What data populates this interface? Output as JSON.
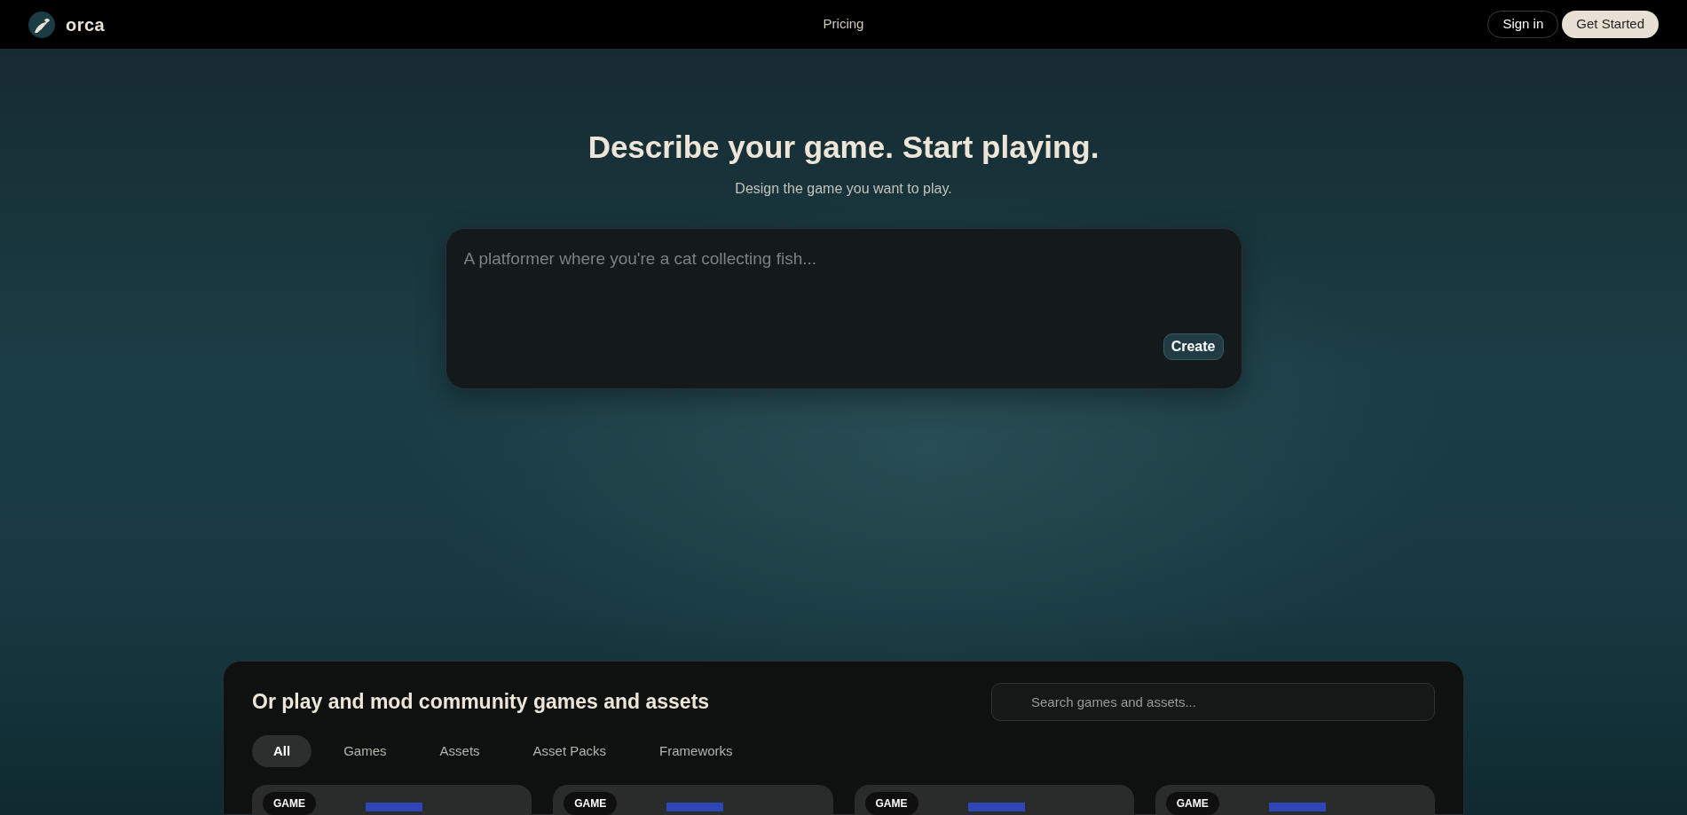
{
  "nav": {
    "brand": "orca",
    "links": [
      "Pricing"
    ],
    "sign_in": "Sign in",
    "get_started": "Get Started"
  },
  "hero": {
    "title": "Describe your game. Start playing.",
    "subtitle": "Design the game you want to play.",
    "prompt": {
      "placeholder": "A platformer where you're a cat collecting fish..."
    },
    "create": "Create"
  },
  "community": {
    "title": "Or play and mod community games and assets",
    "search": {
      "placeholder": "Search games and assets..."
    },
    "tabs": [
      {
        "label": "All",
        "selected": true
      },
      {
        "label": "Games",
        "selected": false
      },
      {
        "label": "Assets",
        "selected": false
      },
      {
        "label": "Asset Packs",
        "selected": false
      },
      {
        "label": "Frameworks",
        "selected": false
      }
    ],
    "cards": [
      {
        "badge": "GAME"
      },
      {
        "badge": "GAME"
      },
      {
        "badge": "GAME"
      },
      {
        "badge": "GAME"
      }
    ]
  }
}
